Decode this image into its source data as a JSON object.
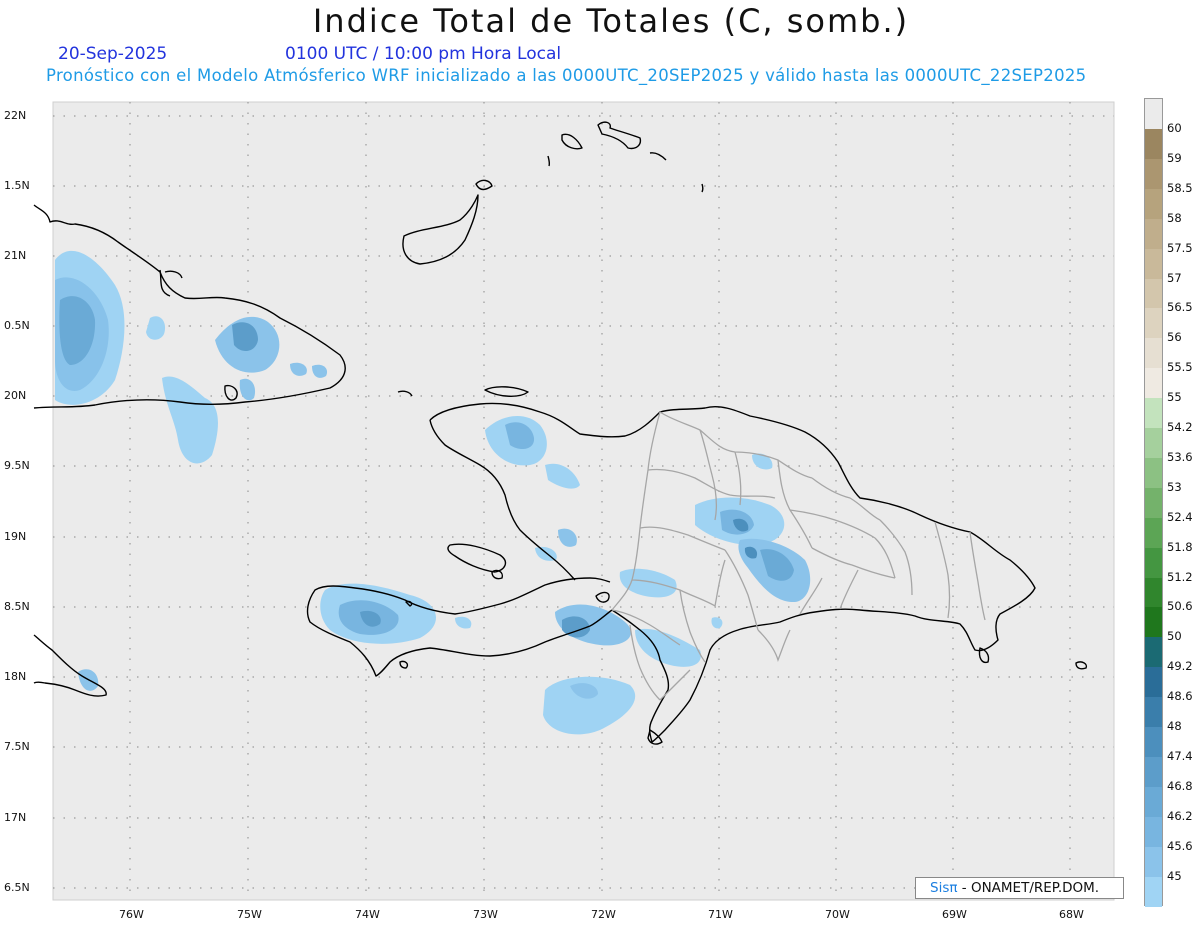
{
  "title": "Indice Total de Totales (C, somb.)",
  "date": "20-Sep-2025",
  "time": "0100 UTC / 10:00 pm Hora Local",
  "subtitle": "Pronóstico con el Modelo Atmósferico WRF inicializado a las 0000UTC_20SEP2025 y válido hasta las  0000UTC_22SEP2025",
  "credit": {
    "brand": "Sisπ",
    "text": "- ONAMET/REP.DOM."
  },
  "map": {
    "lat_labels": [
      "22N",
      "1.5N",
      "21N",
      "0.5N",
      "20N",
      "9.5N",
      "19N",
      "8.5N",
      "18N",
      "7.5N",
      "17N",
      "6.5N"
    ],
    "lon_labels": [
      "76W",
      "75W",
      "74W",
      "73W",
      "72W",
      "71W",
      "70W",
      "69W",
      "68W"
    ],
    "background": "#ebebeb",
    "coast_color": "#000000",
    "border_color": "#a0a0a0"
  },
  "colorbar": {
    "labels": [
      "60",
      "59",
      "58.5",
      "58",
      "57.5",
      "57",
      "56.5",
      "56",
      "55.5",
      "55",
      "54.2",
      "53.6",
      "53",
      "52.4",
      "51.8",
      "51.2",
      "50.6",
      "50",
      "49.2",
      "48.6",
      "48",
      "47.4",
      "46.8",
      "46.2",
      "45.6",
      "45"
    ],
    "colors": [
      "#9b8660",
      "#ab9670",
      "#b6a37d",
      "#c0ae8c",
      "#c9b99a",
      "#d3c6ac",
      "#ddd3bf",
      "#e6dfd2",
      "#efeae2",
      "#c3e3bd",
      "#a5d09d",
      "#8cc183",
      "#74b26b",
      "#5ca555",
      "#449641",
      "#30862d",
      "#1f771d",
      "#1b6a73",
      "#2a6d98",
      "#3a7eab",
      "#4c8fbd",
      "#5c9dca",
      "#6aaad6",
      "#78b5e0",
      "#8bc3ea",
      "#a0d4f4"
    ]
  },
  "fields": [
    {
      "name": "western-cuba",
      "level": "45.6"
    },
    {
      "name": "haiti-north",
      "level": "46.2"
    },
    {
      "name": "haiti-south",
      "level": "46.8"
    },
    {
      "name": "dominican-center",
      "level": "47.4"
    },
    {
      "name": "caribbean-south",
      "level": "45"
    }
  ]
}
